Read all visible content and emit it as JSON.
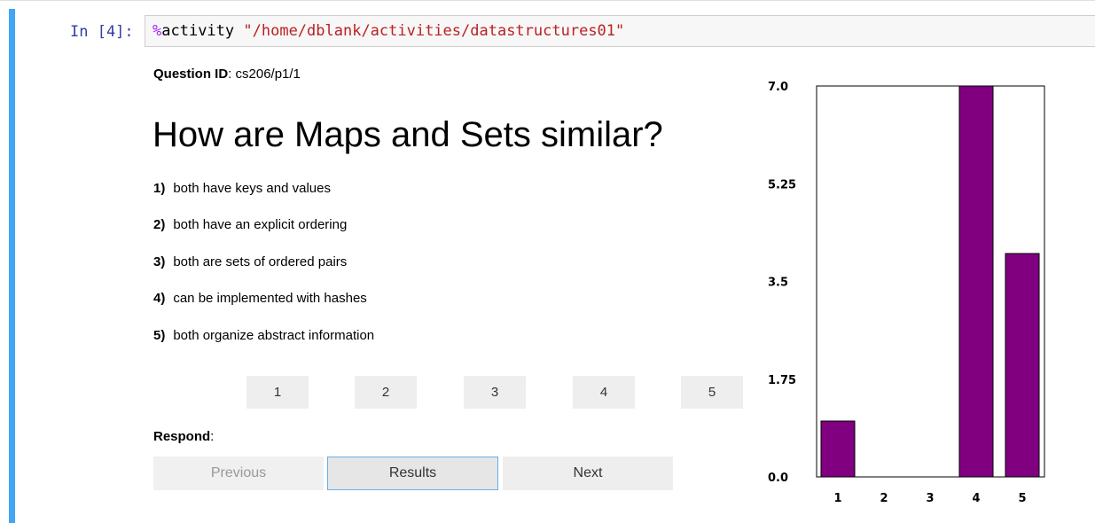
{
  "cell": {
    "prompt": "In [4]:",
    "magic_pct": "%",
    "magic_name": "activity",
    "magic_arg": "\"/home/dblank/activities/datastructures01\""
  },
  "question": {
    "id_label": "Question ID",
    "id_value": ": cs206/p1/1",
    "title": "How are Maps and Sets similar?",
    "choices": [
      {
        "num": "1)",
        "text": "both have keys and values"
      },
      {
        "num": "2)",
        "text": "both have an explicit ordering"
      },
      {
        "num": "3)",
        "text": "both are sets of ordered pairs"
      },
      {
        "num": "4)",
        "text": "can be implemented with hashes"
      },
      {
        "num": "5)",
        "text": "both organize abstract information"
      }
    ],
    "choice_buttons": [
      "1",
      "2",
      "3",
      "4",
      "5"
    ],
    "respond_label": "Respond",
    "respond_colon": ":",
    "nav": {
      "previous": "Previous",
      "results": "Results",
      "next": "Next"
    }
  },
  "colors": {
    "bar": "#800080",
    "cell_border": "#42a5f5"
  },
  "chart_data": {
    "type": "bar",
    "categories": [
      "1",
      "2",
      "3",
      "4",
      "5"
    ],
    "values": [
      1,
      0,
      0,
      7,
      4
    ],
    "y_ticks": [
      "0.0",
      "1.75",
      "3.5",
      "5.25",
      "7.0"
    ],
    "ylim": [
      0,
      7
    ],
    "grid": false
  }
}
